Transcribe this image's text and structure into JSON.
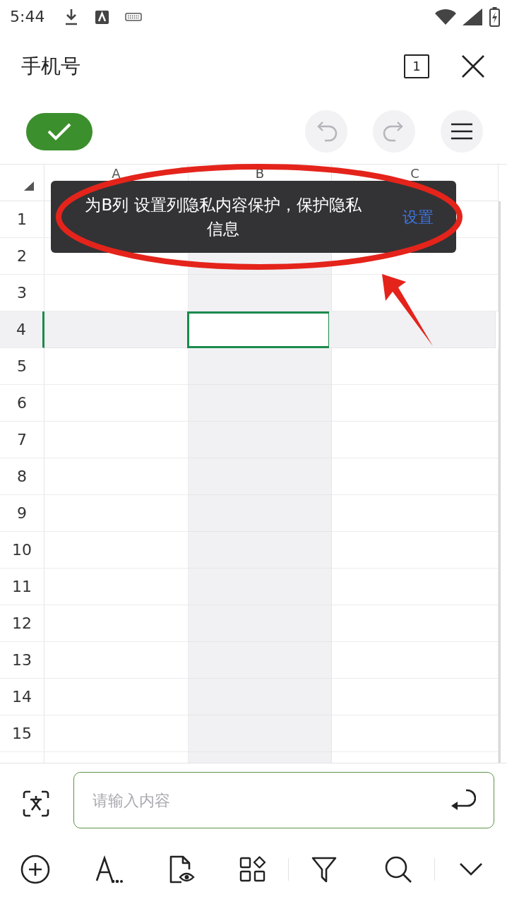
{
  "status_bar": {
    "time": "5:44"
  },
  "header": {
    "title": "手机号",
    "sheet_count": "1"
  },
  "toolbar": [
    {
      "kind": "confirm",
      "disabled": false
    },
    {
      "kind": "undo",
      "disabled": true
    },
    {
      "kind": "redo",
      "disabled": true
    },
    {
      "kind": "menu",
      "disabled": false
    }
  ],
  "sheet": {
    "columns": [
      {
        "label": "A",
        "selected": false
      },
      {
        "label": "B",
        "selected": true
      },
      {
        "label": "C",
        "selected": false
      }
    ],
    "rows": [
      {
        "label": "1",
        "selected": false
      },
      {
        "label": "2",
        "selected": false
      },
      {
        "label": "3",
        "selected": false
      },
      {
        "label": "4",
        "selected": true
      },
      {
        "label": "5",
        "selected": false
      },
      {
        "label": "6",
        "selected": false
      },
      {
        "label": "7",
        "selected": false
      },
      {
        "label": "8",
        "selected": false
      },
      {
        "label": "9",
        "selected": false
      },
      {
        "label": "10",
        "selected": false
      },
      {
        "label": "11",
        "selected": false
      },
      {
        "label": "12",
        "selected": false
      },
      {
        "label": "13",
        "selected": false
      },
      {
        "label": "14",
        "selected": false
      },
      {
        "label": "15",
        "selected": false
      }
    ]
  },
  "toast": {
    "message": "为B列 设置列隐私内容保护，保护隐私信息",
    "action": "设置"
  },
  "input_bar": {
    "placeholder": "请输入内容"
  }
}
